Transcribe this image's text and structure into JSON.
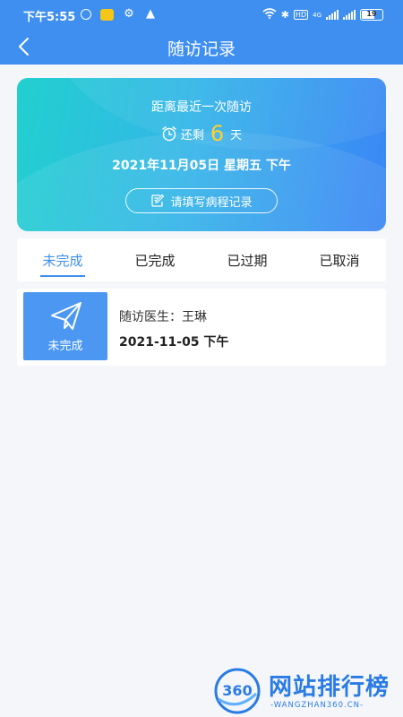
{
  "status_bar": {
    "time": "下午5:55",
    "battery": "19",
    "network_label": "4G",
    "hd_label": "HD",
    "icons": [
      "alarm-icon",
      "app-notification-icon",
      "gear-icon",
      "warning-icon",
      "wifi-icon",
      "bluetooth-icon",
      "signal-icon",
      "battery-icon"
    ]
  },
  "header": {
    "title": "随访记录",
    "back_icon": "chevron-left-icon"
  },
  "banner": {
    "label": "距离最近一次随访",
    "remain_prefix": "还剩",
    "remain_days": "6",
    "remain_unit": "天",
    "date": "2021年11月05日 星期五 下午",
    "record_button": "请填写病程记录",
    "accent_color": "#ffd02b"
  },
  "tabs": [
    {
      "label": "未完成",
      "active": true
    },
    {
      "label": "已完成",
      "active": false
    },
    {
      "label": "已过期",
      "active": false
    },
    {
      "label": "已取消",
      "active": false
    }
  ],
  "records": [
    {
      "status": "未完成",
      "doctor_label": "随访医生：",
      "doctor_name": "王琳",
      "time": "2021-11-05 下午"
    }
  ],
  "watermark": {
    "logo": "360",
    "text": "网站排行榜",
    "sub": "-WANGZHAN360.CN-"
  },
  "colors": {
    "primary": "#3f8ff0",
    "banner_start": "#21d0cf",
    "banner_end": "#3c86f5",
    "background": "#f4f6fa"
  }
}
